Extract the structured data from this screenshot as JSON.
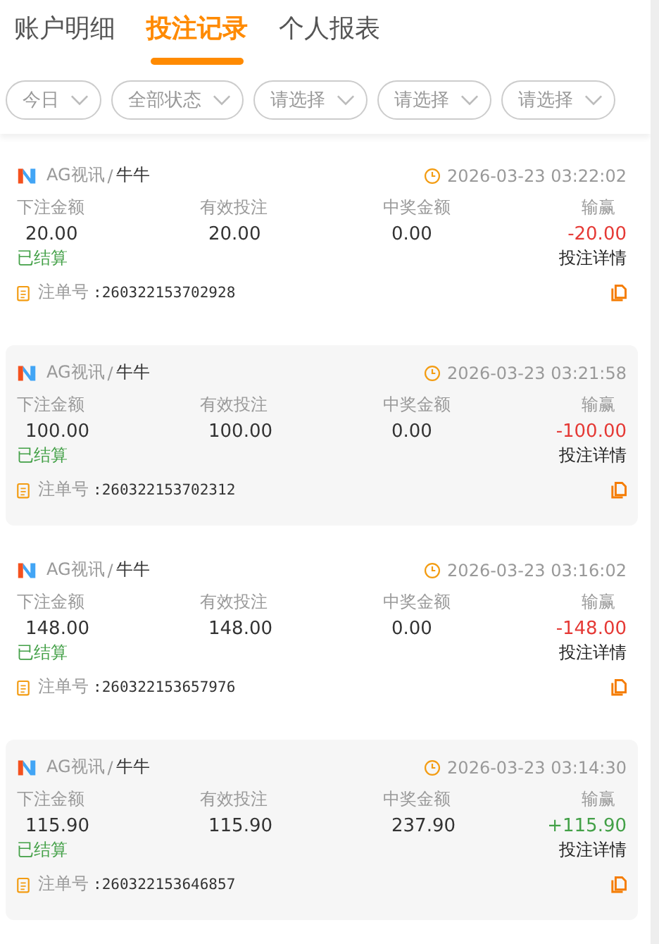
{
  "tabs": [
    {
      "label": "账户明细",
      "selected": false
    },
    {
      "label": "投注记录",
      "selected": true
    },
    {
      "label": "个人报表",
      "selected": false
    }
  ],
  "filters": [
    {
      "label": "今日"
    },
    {
      "label": "全部状态"
    },
    {
      "label": "请选择"
    },
    {
      "label": "请选择"
    },
    {
      "label": "请选择"
    }
  ],
  "records": [
    {
      "platform": "AG视讯",
      "separator": "/",
      "game": "牛牛",
      "time": "2026-03-23 03:22:02",
      "columns": [
        "下注金额",
        "有效投注",
        "中奖金额",
        "输赢"
      ],
      "bet": "20.00",
      "valid": "20.00",
      "payout": "0.00",
      "result": "-20.00",
      "color": "#e53935",
      "status": "已结算",
      "detail": "投注详情",
      "order_label": "注单号",
      "order_no": ":260322153702928"
    },
    {
      "platform": "AG视讯",
      "separator": "/",
      "game": "牛牛",
      "time": "2026-03-23 03:21:58",
      "columns": [
        "下注金额",
        "有效投注",
        "中奖金额",
        "输赢"
      ],
      "bet": "100.00",
      "valid": "100.00",
      "payout": "0.00",
      "result": "-100.00",
      "color": "#e53935",
      "status": "已结算",
      "detail": "投注详情",
      "order_label": "注单号",
      "order_no": ":260322153702312"
    },
    {
      "platform": "AG视讯",
      "separator": "/",
      "game": "牛牛",
      "time": "2026-03-23 03:16:02",
      "columns": [
        "下注金额",
        "有效投注",
        "中奖金额",
        "输赢"
      ],
      "bet": "148.00",
      "valid": "148.00",
      "payout": "0.00",
      "result": "-148.00",
      "color": "#e53935",
      "status": "已结算",
      "detail": "投注详情",
      "order_label": "注单号",
      "order_no": ":260322153657976"
    },
    {
      "platform": "AG视讯",
      "separator": "/",
      "game": "牛牛",
      "time": "2026-03-23 03:14:30",
      "columns": [
        "下注金额",
        "有效投注",
        "中奖金额",
        "输赢"
      ],
      "bet": "115.90",
      "valid": "115.90",
      "payout": "237.90",
      "result": "+115.90",
      "color": "#43a047",
      "status": "已结算",
      "detail": "投注详情",
      "order_label": "注单号",
      "order_no": ":260322153646857"
    }
  ]
}
